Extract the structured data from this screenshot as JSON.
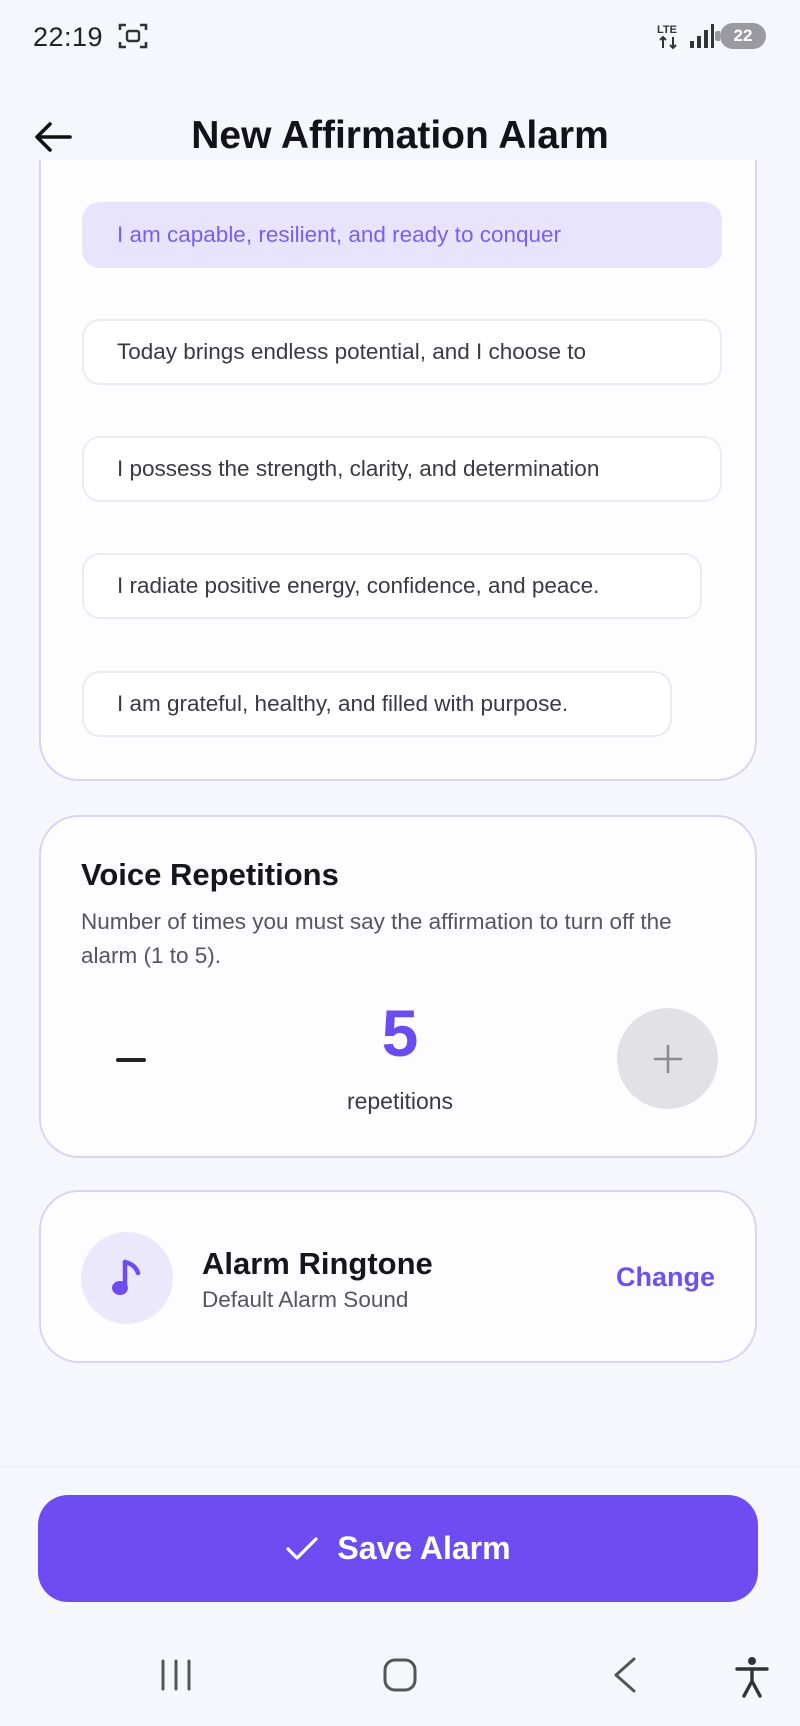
{
  "status_bar": {
    "time": "22:19",
    "network": "LTE",
    "battery_level": "22"
  },
  "header": {
    "title": "New Affirmation Alarm",
    "back_icon": "arrow-left-icon"
  },
  "affirmations": {
    "items": [
      {
        "text": "I am capable, resilient, and ready to conquer",
        "selected": true
      },
      {
        "text": "Today brings endless potential, and I choose to",
        "selected": false
      },
      {
        "text": "I possess the strength, clarity, and determination",
        "selected": false
      },
      {
        "text": "I radiate positive energy, confidence, and peace.",
        "selected": false
      },
      {
        "text": "I am grateful, healthy, and filled with purpose.",
        "selected": false
      }
    ]
  },
  "voice_repetitions": {
    "title": "Voice Repetitions",
    "description": "Number of times you must say the affirmation to turn off the alarm (1 to 5).",
    "value": "5",
    "unit_label": "repetitions",
    "min": 1,
    "max": 5
  },
  "ringtone": {
    "title": "Alarm Ringtone",
    "subtitle": "Default Alarm Sound",
    "change_label": "Change",
    "icon": "music-note-icon"
  },
  "footer": {
    "save_label": "Save Alarm",
    "save_icon": "checkmark-icon"
  },
  "colors": {
    "accent": "#6d4df2",
    "selected_bg": "#e9e4fd",
    "selected_text": "#7a5ef0",
    "card_border": "#d9d3f4",
    "background": "#f6f7fc"
  }
}
